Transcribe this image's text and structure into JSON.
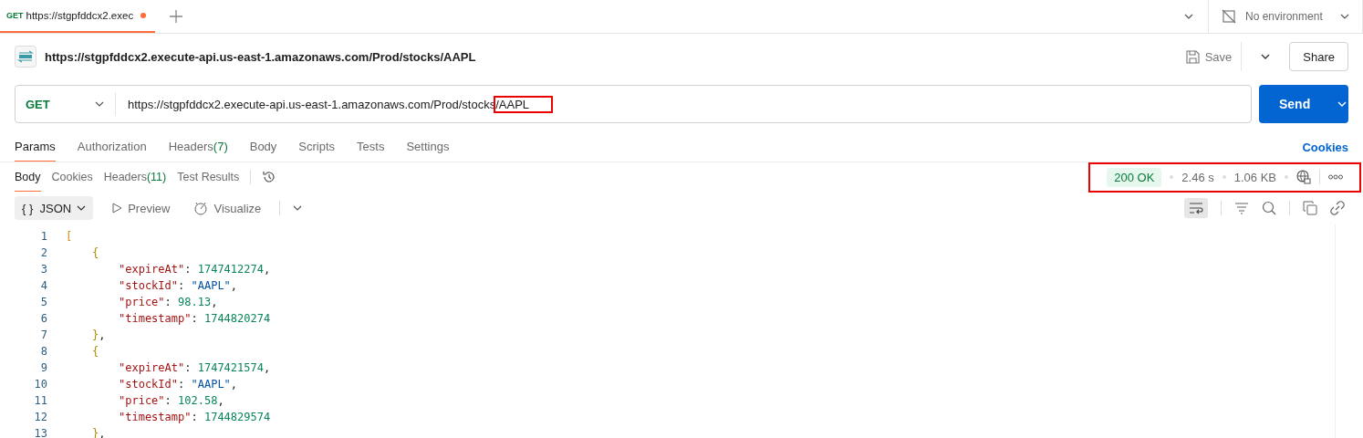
{
  "top_tabs": [
    {
      "method": "GET",
      "title": "https://stgpfddcx2.exec",
      "unsaved": true,
      "selected": true
    }
  ],
  "environment": {
    "label": "No environment"
  },
  "request_header": {
    "title": "https://stgpfddcx2.execute-api.us-east-1.amazonaws.com/Prod/stocks/AAPL",
    "save": "Save",
    "share": "Share"
  },
  "request": {
    "method": "GET",
    "url_parts": [
      {
        "text": "https://stgpfddcx2.execute-api.us-east-1.amazonaws.com/Prod/stocks",
        "highlighted": false
      },
      {
        "text": "/AAPL",
        "highlighted": true
      }
    ],
    "send": "Send"
  },
  "request_tabs": [
    {
      "label": "Params",
      "selected": true
    },
    {
      "label": "Authorization",
      "selected": false
    },
    {
      "label": "Headers",
      "count": "(7)",
      "selected": false
    },
    {
      "label": "Body",
      "selected": false
    },
    {
      "label": "Scripts",
      "selected": false
    },
    {
      "label": "Tests",
      "selected": false
    },
    {
      "label": "Settings",
      "selected": false
    }
  ],
  "cookies_link": "Cookies",
  "response_tabs": [
    {
      "label": "Body",
      "selected": true
    },
    {
      "label": "Cookies",
      "selected": false
    },
    {
      "label": "Headers",
      "count": "(11)",
      "selected": false
    },
    {
      "label": "Test Results",
      "selected": false
    }
  ],
  "response_meta": {
    "status": "200 OK",
    "time": "2.46 s",
    "size": "1.06 KB",
    "highlighted": true
  },
  "body_toolbar": {
    "format_glyph": "{ }",
    "format": "JSON",
    "preview": "Preview",
    "visualize": "Visualize",
    "wrap_on": true
  },
  "code_lines": [
    {
      "number": "1",
      "tokens": [
        {
          "kind": "bracket",
          "text": "["
        }
      ],
      "children": [
        {
          "number": "2",
          "tokens": [
            {
              "kind": "brace",
              "text": "{"
            }
          ],
          "children": [
            {
              "number": "3",
              "tokens": [
                {
                  "kind": "key",
                  "text": "\"expireAt\""
                },
                {
                  "kind": "punct",
                  "text": ": "
                },
                {
                  "kind": "number",
                  "text": "1747412274"
                },
                {
                  "kind": "punct",
                  "text": ","
                }
              ]
            },
            {
              "number": "4",
              "tokens": [
                {
                  "kind": "key",
                  "text": "\"stockId\""
                },
                {
                  "kind": "punct",
                  "text": ": "
                },
                {
                  "kind": "string",
                  "text": "\"AAPL\""
                },
                {
                  "kind": "punct",
                  "text": ","
                }
              ]
            },
            {
              "number": "5",
              "tokens": [
                {
                  "kind": "key",
                  "text": "\"price\""
                },
                {
                  "kind": "punct",
                  "text": ": "
                },
                {
                  "kind": "number",
                  "text": "98.13"
                },
                {
                  "kind": "punct",
                  "text": ","
                }
              ]
            },
            {
              "number": "6",
              "tokens": [
                {
                  "kind": "key",
                  "text": "\"timestamp\""
                },
                {
                  "kind": "punct",
                  "text": ": "
                },
                {
                  "kind": "number",
                  "text": "1744820274"
                }
              ]
            }
          ]
        },
        {
          "number": "7",
          "tokens": [
            {
              "kind": "brace",
              "text": "}"
            },
            {
              "kind": "punct",
              "text": ","
            }
          ]
        },
        {
          "number": "8",
          "tokens": [
            {
              "kind": "brace",
              "text": "{"
            }
          ],
          "children": [
            {
              "number": "9",
              "tokens": [
                {
                  "kind": "key",
                  "text": "\"expireAt\""
                },
                {
                  "kind": "punct",
                  "text": ": "
                },
                {
                  "kind": "number",
                  "text": "1747421574"
                },
                {
                  "kind": "punct",
                  "text": ","
                }
              ]
            },
            {
              "number": "10",
              "tokens": [
                {
                  "kind": "key",
                  "text": "\"stockId\""
                },
                {
                  "kind": "punct",
                  "text": ": "
                },
                {
                  "kind": "string",
                  "text": "\"AAPL\""
                },
                {
                  "kind": "punct",
                  "text": ","
                }
              ]
            },
            {
              "number": "11",
              "tokens": [
                {
                  "kind": "key",
                  "text": "\"price\""
                },
                {
                  "kind": "punct",
                  "text": ": "
                },
                {
                  "kind": "number",
                  "text": "102.58"
                },
                {
                  "kind": "punct",
                  "text": ","
                }
              ]
            },
            {
              "number": "12",
              "tokens": [
                {
                  "kind": "key",
                  "text": "\"timestamp\""
                },
                {
                  "kind": "punct",
                  "text": ": "
                },
                {
                  "kind": "number",
                  "text": "1744829574"
                }
              ]
            }
          ]
        },
        {
          "number": "13",
          "tokens": [
            {
              "kind": "brace",
              "text": "}"
            },
            {
              "kind": "punct",
              "text": ","
            }
          ]
        }
      ]
    }
  ]
}
